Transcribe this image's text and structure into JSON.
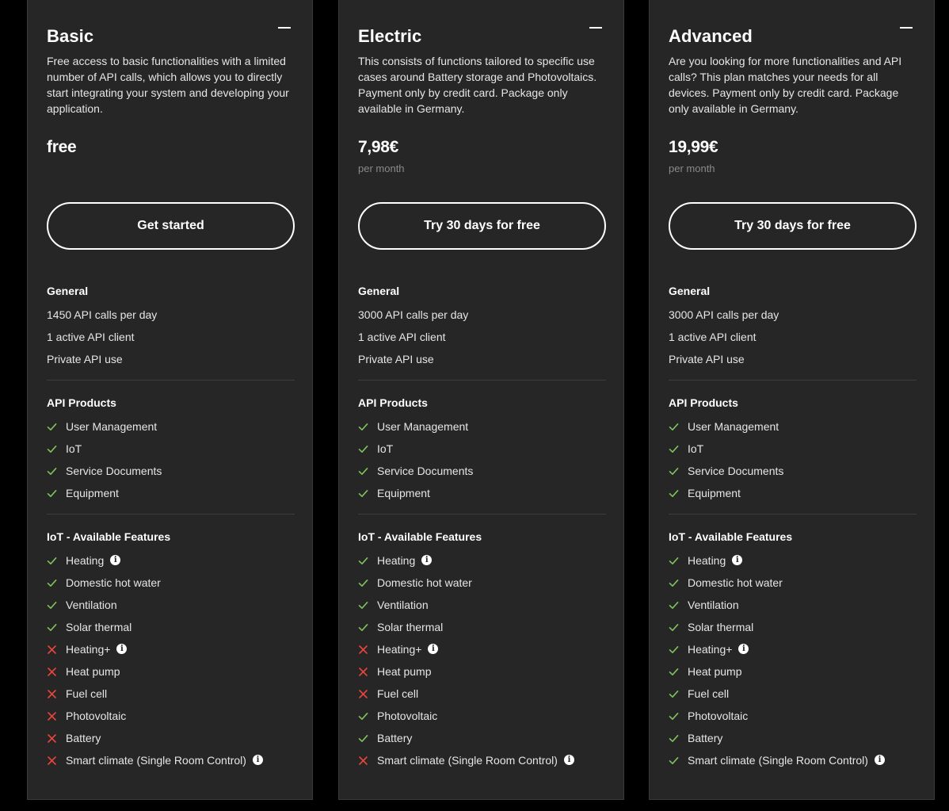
{
  "colors": {
    "background": "#000000",
    "card": "#262626",
    "check": "#7ec35a",
    "cross": "#e8453c",
    "muted": "#8a8a8a"
  },
  "plans": [
    {
      "title": "Basic",
      "description": "Free access to basic functionalities with a limited number of API calls, which allows you to directly start integrating your system and developing your application.",
      "price": "free",
      "period": "",
      "cta": "Get started",
      "general": {
        "title": "General",
        "items": [
          "1450 API calls per day",
          "1 active API client",
          "Private API use"
        ]
      },
      "products": {
        "title": "API Products",
        "items": [
          {
            "label": "User Management",
            "included": true
          },
          {
            "label": "IoT",
            "included": true
          },
          {
            "label": "Service Documents",
            "included": true
          },
          {
            "label": "Equipment",
            "included": true
          }
        ]
      },
      "features": {
        "title": "IoT - Available Features",
        "items": [
          {
            "label": "Heating",
            "included": true,
            "info": true
          },
          {
            "label": "Domestic hot water",
            "included": true,
            "info": false
          },
          {
            "label": "Ventilation",
            "included": true,
            "info": false
          },
          {
            "label": "Solar thermal",
            "included": true,
            "info": false
          },
          {
            "label": "Heating+",
            "included": false,
            "info": true
          },
          {
            "label": "Heat pump",
            "included": false,
            "info": false
          },
          {
            "label": "Fuel cell",
            "included": false,
            "info": false
          },
          {
            "label": "Photovoltaic",
            "included": false,
            "info": false
          },
          {
            "label": "Battery",
            "included": false,
            "info": false
          },
          {
            "label": "Smart climate (Single Room Control)",
            "included": false,
            "info": true
          }
        ]
      }
    },
    {
      "title": "Electric",
      "description": "This consists of functions tailored to specific use cases around Battery storage and Photovoltaics. Payment only by credit card. Package only available in Germany.",
      "price": "7,98€",
      "period": "per month",
      "cta": "Try 30 days for free",
      "general": {
        "title": "General",
        "items": [
          "3000 API calls per day",
          "1 active API client",
          "Private API use"
        ]
      },
      "products": {
        "title": "API Products",
        "items": [
          {
            "label": "User Management",
            "included": true
          },
          {
            "label": "IoT",
            "included": true
          },
          {
            "label": "Service Documents",
            "included": true
          },
          {
            "label": "Equipment",
            "included": true
          }
        ]
      },
      "features": {
        "title": "IoT - Available Features",
        "items": [
          {
            "label": "Heating",
            "included": true,
            "info": true
          },
          {
            "label": "Domestic hot water",
            "included": true,
            "info": false
          },
          {
            "label": "Ventilation",
            "included": true,
            "info": false
          },
          {
            "label": "Solar thermal",
            "included": true,
            "info": false
          },
          {
            "label": "Heating+",
            "included": false,
            "info": true
          },
          {
            "label": "Heat pump",
            "included": false,
            "info": false
          },
          {
            "label": "Fuel cell",
            "included": false,
            "info": false
          },
          {
            "label": "Photovoltaic",
            "included": true,
            "info": false
          },
          {
            "label": "Battery",
            "included": true,
            "info": false
          },
          {
            "label": "Smart climate (Single Room Control)",
            "included": false,
            "info": true
          }
        ]
      }
    },
    {
      "title": "Advanced",
      "description": "Are you looking for more functionalities and API calls? This plan matches your needs for all devices. Payment only by credit card. Package only available in Germany.",
      "price": "19,99€",
      "period": "per month",
      "cta": "Try 30 days for free",
      "general": {
        "title": "General",
        "items": [
          "3000 API calls per day",
          "1 active API client",
          "Private API use"
        ]
      },
      "products": {
        "title": "API Products",
        "items": [
          {
            "label": "User Management",
            "included": true
          },
          {
            "label": "IoT",
            "included": true
          },
          {
            "label": "Service Documents",
            "included": true
          },
          {
            "label": "Equipment",
            "included": true
          }
        ]
      },
      "features": {
        "title": "IoT - Available Features",
        "items": [
          {
            "label": "Heating",
            "included": true,
            "info": true
          },
          {
            "label": "Domestic hot water",
            "included": true,
            "info": false
          },
          {
            "label": "Ventilation",
            "included": true,
            "info": false
          },
          {
            "label": "Solar thermal",
            "included": true,
            "info": false
          },
          {
            "label": "Heating+",
            "included": true,
            "info": true
          },
          {
            "label": "Heat pump",
            "included": true,
            "info": false
          },
          {
            "label": "Fuel cell",
            "included": true,
            "info": false
          },
          {
            "label": "Photovoltaic",
            "included": true,
            "info": false
          },
          {
            "label": "Battery",
            "included": true,
            "info": false
          },
          {
            "label": "Smart climate (Single Room Control)",
            "included": true,
            "info": true
          }
        ]
      }
    }
  ]
}
